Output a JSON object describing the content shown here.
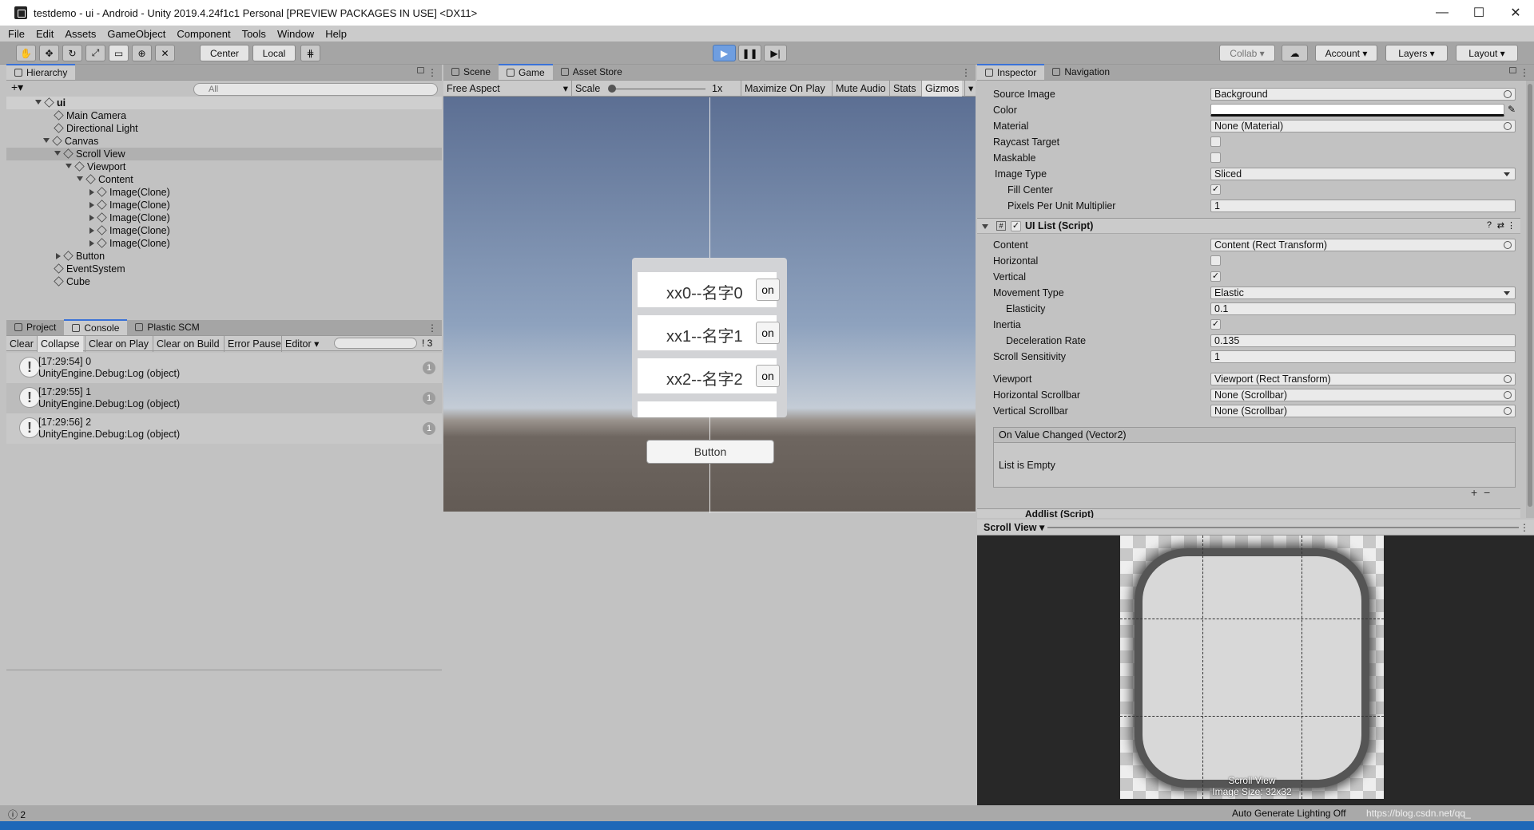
{
  "window": {
    "title": "testdemo - ui - Android - Unity 2019.4.24f1c1 Personal [PREVIEW PACKAGES IN USE] <DX11>",
    "minimize": "—",
    "maximize": "☐",
    "close": "✕"
  },
  "menu": [
    "File",
    "Edit",
    "Assets",
    "GameObject",
    "Component",
    "Tools",
    "Window",
    "Help"
  ],
  "toolbar": {
    "center": "Center",
    "local": "Local",
    "collab": "Collab",
    "account": "Account",
    "layers": "Layers",
    "layout": "Layout"
  },
  "hierarchy": {
    "tab": "Hierarchy",
    "search_placeholder": "All",
    "items": [
      "ui",
      "Main Camera",
      "Directional Light",
      "Canvas",
      "Scroll View",
      "Viewport",
      "Content",
      "Image(Clone)",
      "Image(Clone)",
      "Image(Clone)",
      "Image(Clone)",
      "Image(Clone)",
      "Button",
      "EventSystem",
      "Cube"
    ]
  },
  "console": {
    "tabs": [
      "Project",
      "Console",
      "Plastic SCM"
    ],
    "buttons": [
      "Clear",
      "Collapse",
      "Clear on Play",
      "Clear on Build",
      "Error Pause",
      "Editor"
    ],
    "count": "3",
    "logs": [
      {
        "time": "[17:29:54] 0",
        "msg": "UnityEngine.Debug:Log (object)",
        "count": "1"
      },
      {
        "time": "[17:29:55] 1",
        "msg": "UnityEngine.Debug:Log (object)",
        "count": "1"
      },
      {
        "time": "[17:29:56] 2",
        "msg": "UnityEngine.Debug:Log (object)",
        "count": "1"
      }
    ]
  },
  "game": {
    "tabs": [
      "Scene",
      "Game",
      "Asset Store"
    ],
    "aspect": "Free Aspect",
    "scale_label": "Scale",
    "scale_value": "1x",
    "buttons": [
      "Maximize On Play",
      "Mute Audio",
      "Stats",
      "Gizmos"
    ],
    "items": [
      {
        "label": "xx0--名字0",
        "btn": "on"
      },
      {
        "label": "xx1--名字1",
        "btn": "on"
      },
      {
        "label": "xx2--名字2",
        "btn": "on"
      }
    ],
    "button_label": "Button"
  },
  "inspector": {
    "tabs": [
      "Inspector",
      "Navigation"
    ],
    "image": [
      {
        "label": "Source Image",
        "value": "Background"
      },
      {
        "label": "Color",
        "value": ""
      },
      {
        "label": "Material",
        "value": "None (Material)"
      },
      {
        "label": "Raycast Target",
        "value": ""
      },
      {
        "label": "Maskable",
        "value": ""
      },
      {
        "label": "Image Type",
        "value": "Sliced"
      },
      {
        "label": "Fill Center",
        "value": "✓"
      },
      {
        "label": "Pixels Per Unit Multiplier",
        "value": "1"
      }
    ],
    "component_title": "UI List (Script)",
    "uilist": [
      {
        "label": "Content",
        "value": "Content (Rect Transform)"
      },
      {
        "label": "Horizontal",
        "value": ""
      },
      {
        "label": "Vertical",
        "value": "✓"
      },
      {
        "label": "Movement Type",
        "value": "Elastic"
      },
      {
        "label": "Elasticity",
        "value": "0.1"
      },
      {
        "label": "Inertia",
        "value": "✓"
      },
      {
        "label": "Deceleration Rate",
        "value": "0.135"
      },
      {
        "label": "Scroll Sensitivity",
        "value": "1"
      },
      {
        "label": "Viewport",
        "value": "Viewport (Rect Transform)"
      },
      {
        "label": "Horizontal Scrollbar",
        "value": "None (Scrollbar)"
      },
      {
        "label": "Vertical Scrollbar",
        "value": "None (Scrollbar)"
      }
    ],
    "event_title": "On Value Changed (Vector2)",
    "event_empty": "List is Empty",
    "next_component": "Addlist (Script)",
    "preview_name": "Scroll View",
    "preview_caption": "Scroll View",
    "preview_size": "Image Size: 32x32"
  },
  "status": {
    "left": "2",
    "right": "Auto Generate Lighting Off",
    "watermark": "https://blog.csdn.net/qq_"
  }
}
